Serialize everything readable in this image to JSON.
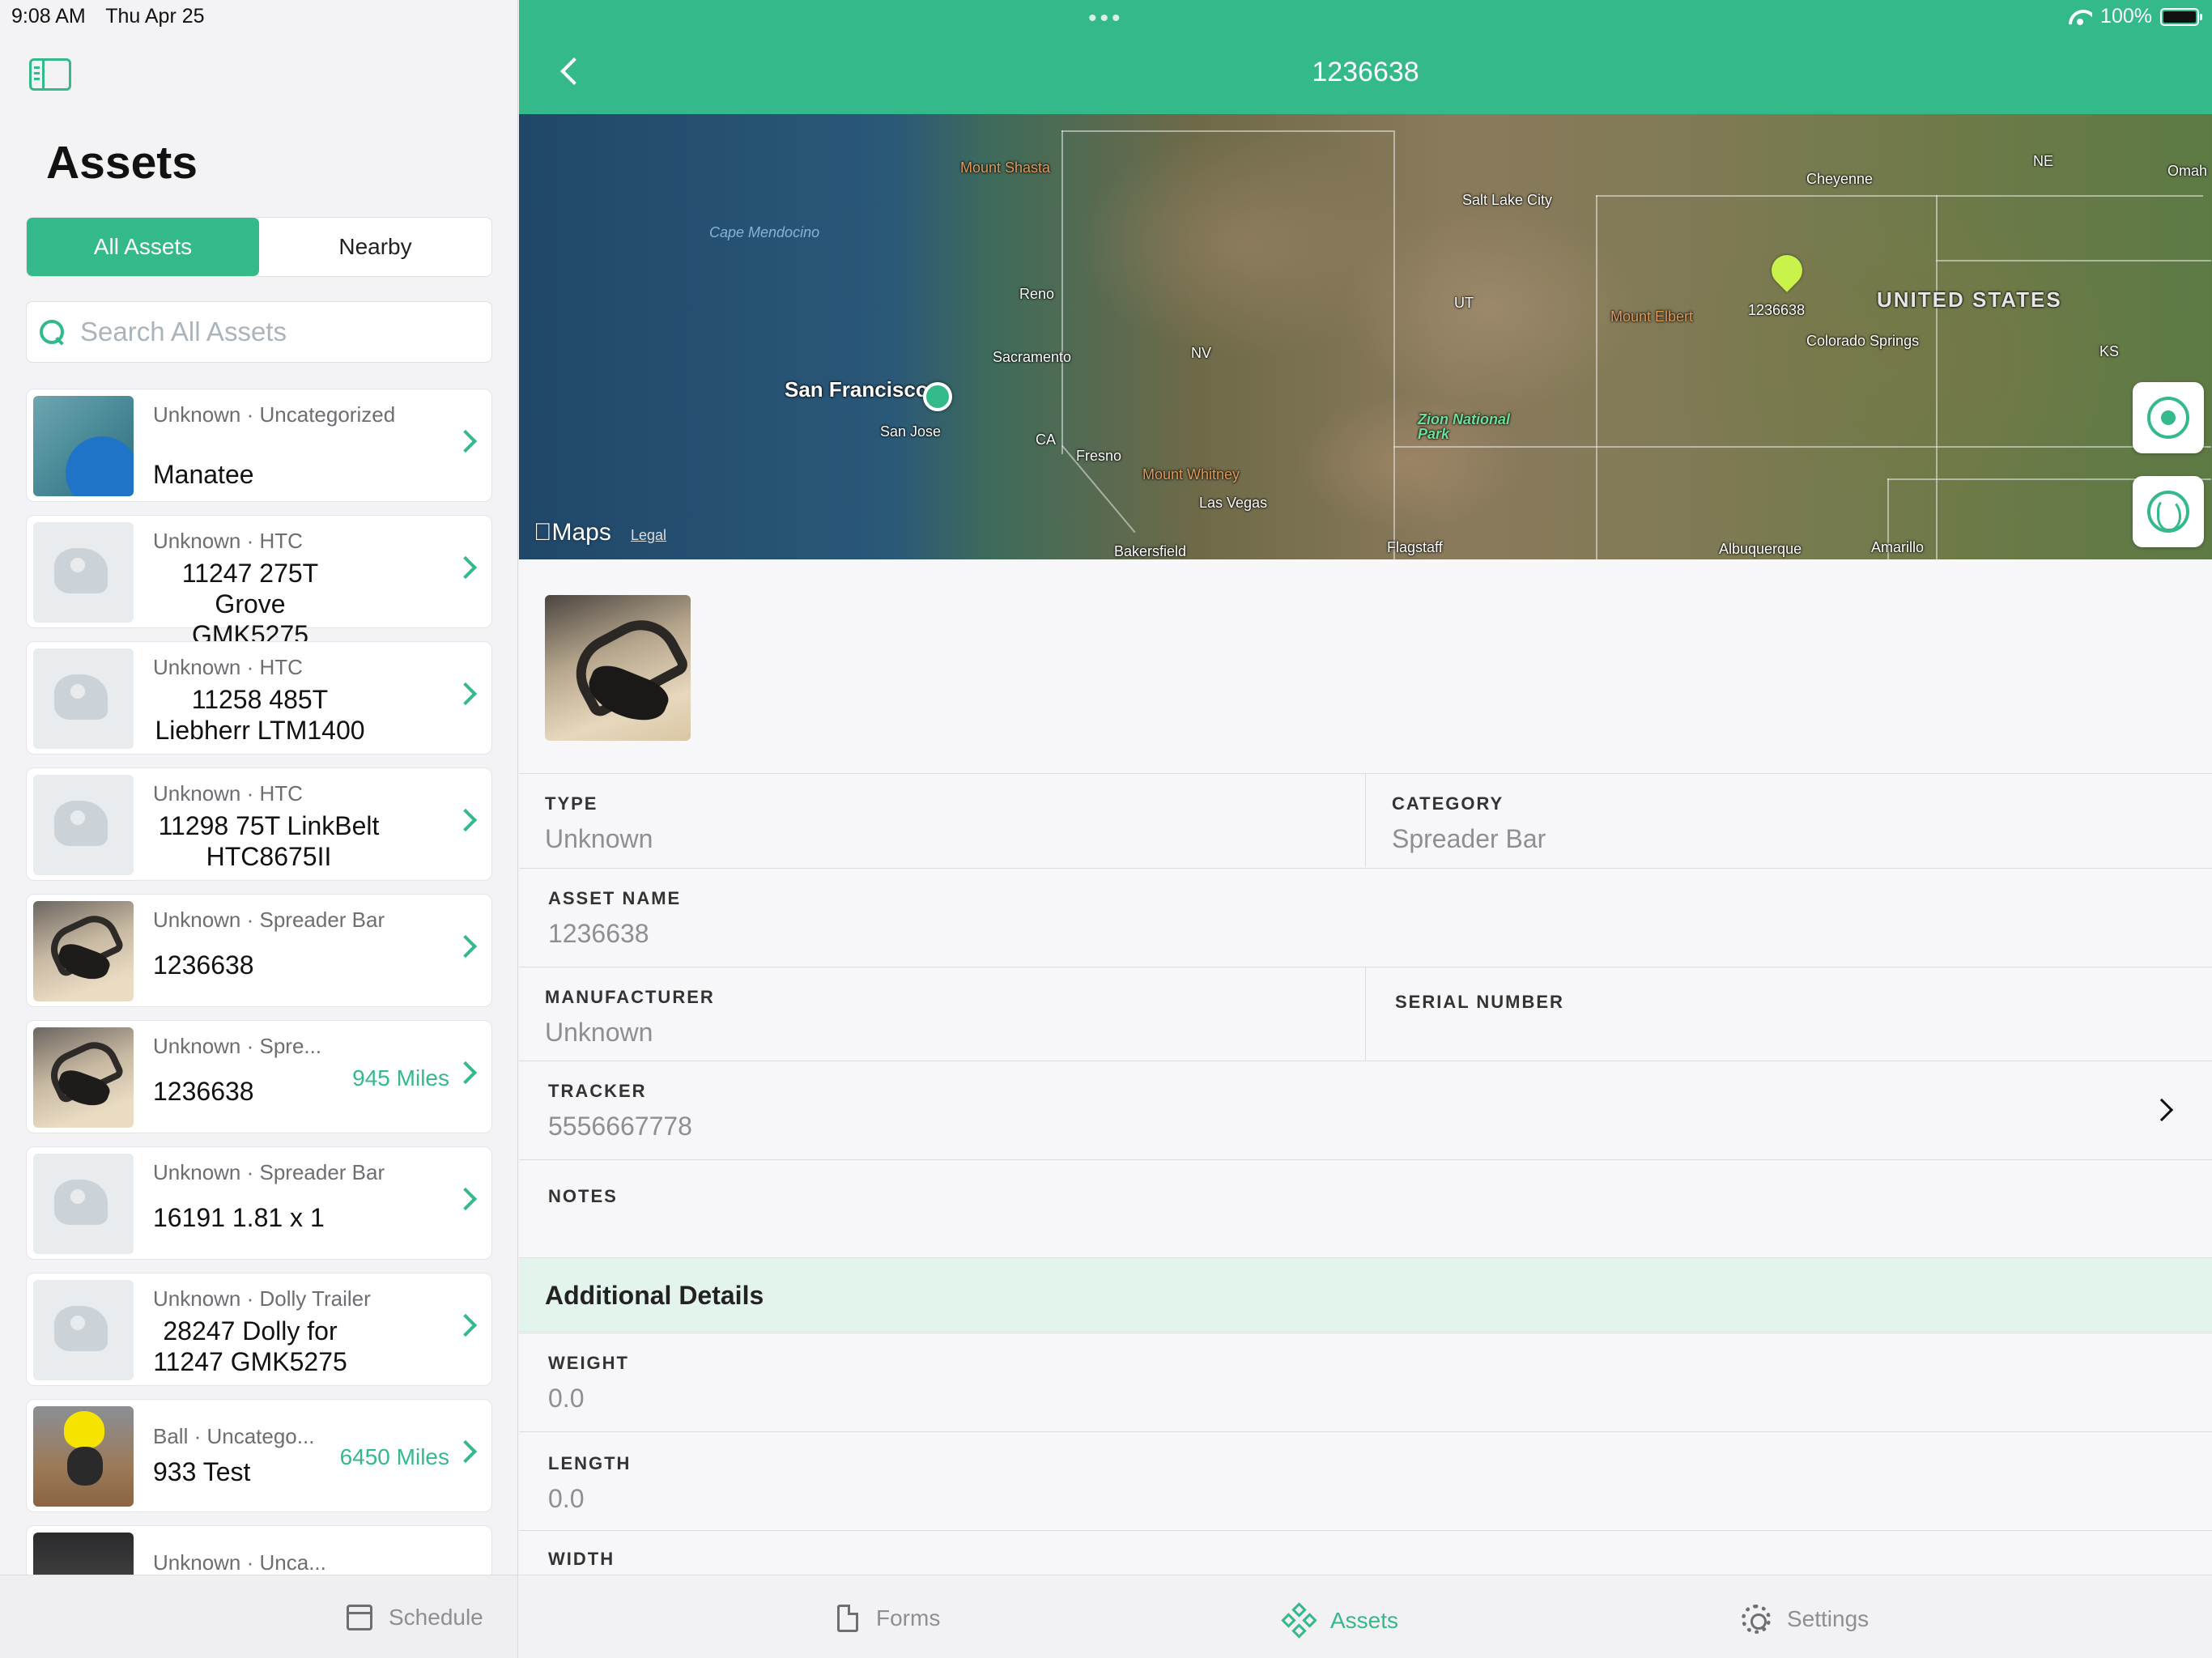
{
  "status": {
    "time": "9:08 AM",
    "date": "Thu Apr 25",
    "battery": "100%"
  },
  "sidebar": {
    "title": "Assets",
    "segments": [
      "All Assets",
      "Nearby"
    ],
    "search_placeholder": "Search All Assets",
    "items": [
      {
        "meta": "Unknown · Uncategorized",
        "name": "Manatee",
        "distance": ""
      },
      {
        "meta": "Unknown · HTC",
        "name": "11247 275T Grove GMK5275",
        "distance": ""
      },
      {
        "meta": "Unknown · HTC",
        "name": "11258 485T Liebherr LTM1400",
        "distance": ""
      },
      {
        "meta": "Unknown · HTC",
        "name": "11298 75T LinkBelt HTC8675II",
        "distance": ""
      },
      {
        "meta": "Unknown · Spreader Bar",
        "name": "1236638",
        "distance": ""
      },
      {
        "meta": "Unknown · Spre...",
        "name": "1236638",
        "distance": "945 Miles"
      },
      {
        "meta": "Unknown · Spreader Bar",
        "name": "16191 1.81 x 1",
        "distance": ""
      },
      {
        "meta": "Unknown · Dolly Trailer",
        "name": "28247 Dolly for 11247 GMK5275",
        "distance": ""
      },
      {
        "meta": "Ball · Uncatego...",
        "name": "933 Test",
        "distance": "6450 Miles"
      },
      {
        "meta": "Unknown · Unca...",
        "name": "",
        "distance": ""
      }
    ],
    "tab_schedule": "Schedule"
  },
  "detail": {
    "title": "1236638",
    "map": {
      "logo": "Maps",
      "legal": "Legal",
      "labels": {
        "mount_shasta": "Mount Shasta",
        "cape_mendocino": "Cape Mendocino",
        "reno": "Reno",
        "sacramento": "Sacramento",
        "san_francisco": "San Francisco",
        "san_jose": "San Jose",
        "ca": "CA",
        "fresno": "Fresno",
        "mount_whitney": "Mount Whitney",
        "las_vegas": "Las Vegas",
        "bakersfield": "Bakersfield",
        "nv": "NV",
        "salt_lake_city": "Salt Lake City",
        "ut": "UT",
        "zion": "Zion National Park",
        "flagstaff": "Flagstaff",
        "cheyenne": "Cheyenne",
        "mount_elbert": "Mount Elbert",
        "pin_label": "1236638",
        "united_states": "UNITED STATES",
        "colorado_springs": "Colorado Springs",
        "albuquerque": "Albuquerque",
        "amarillo": "Amarillo",
        "ne": "NE",
        "ks": "KS",
        "omaha": "Omah"
      }
    },
    "fields": {
      "type_label": "TYPE",
      "type_value": "Unknown",
      "category_label": "CATEGORY",
      "category_value": "Spreader Bar",
      "asset_name_label": "ASSET NAME",
      "asset_name_value": "1236638",
      "manufacturer_label": "MANUFACTURER",
      "manufacturer_value": "Unknown",
      "serial_label": "SERIAL NUMBER",
      "serial_value": "",
      "tracker_label": "TRACKER",
      "tracker_value": "5556667778",
      "notes_label": "NOTES",
      "notes_value": ""
    },
    "additional": {
      "title": "Additional Details",
      "weight_label": "WEIGHT",
      "weight_value": "0.0",
      "length_label": "LENGTH",
      "length_value": "0.0",
      "width_label": "WIDTH"
    }
  },
  "tabbar": {
    "forms": "Forms",
    "assets": "Assets",
    "settings": "Settings"
  },
  "colors": {
    "accent": "#34b98b",
    "header_bg": "#34b98b",
    "section_bg": "#e3f4ec"
  }
}
